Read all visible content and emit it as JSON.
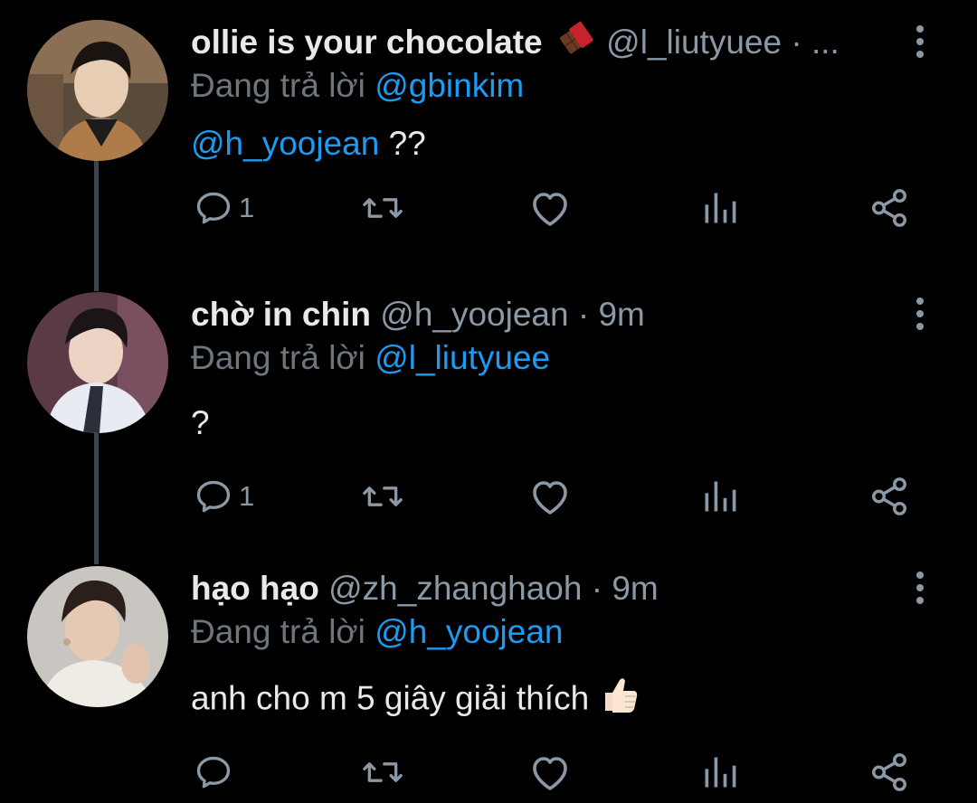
{
  "replying_prefix": "Đang trả lời",
  "tweets": [
    {
      "display_name": "ollie is your chocolate",
      "name_emoji": "chocolate-bar-icon",
      "handle": "@l_liutyuee",
      "meta": "· ...",
      "reply_to": "@gbinkim",
      "body_mention": "@h_yoojean",
      "body_text": " ??",
      "reply_count": "1"
    },
    {
      "display_name": "chờ in chin",
      "handle": "@h_yoojean",
      "meta": "· 9m",
      "reply_to": "@l_liutyuee",
      "body_text": "?",
      "reply_count": "1"
    },
    {
      "display_name": "hạo hạo",
      "handle": "@zh_zhanghaoh",
      "meta": "· 9m",
      "reply_to": "@h_yoojean",
      "body_text": "anh cho m 5 giây giải thích ",
      "body_emoji": "thumbs-up-icon",
      "reply_count": ""
    }
  ],
  "colors": {
    "background": "#000000",
    "primary_text": "#e7e9ea",
    "secondary_text": "#8b98a5",
    "link": "#1d9bf0",
    "connector": "#3d4450"
  }
}
